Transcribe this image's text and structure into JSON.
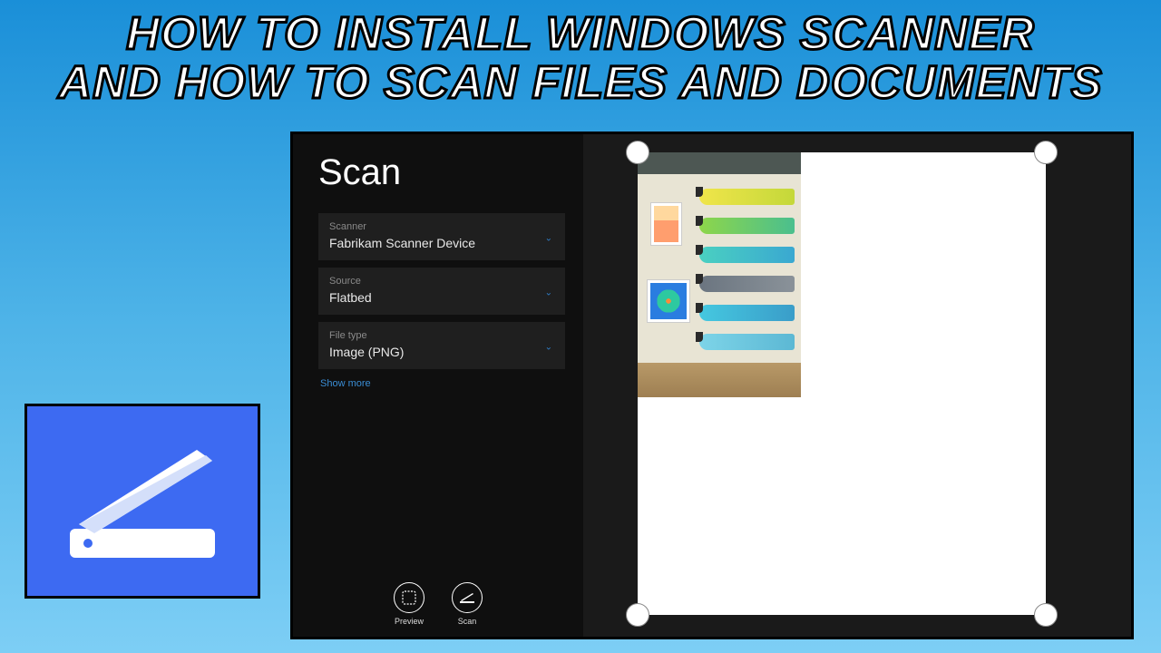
{
  "overlay": {
    "title_line1": "HOW TO INSTALL WINDOWS SCANNER",
    "title_line2": "AND HOW TO SCAN FILES AND DOCUMENTS"
  },
  "app": {
    "title": "Scan",
    "scanner": {
      "label": "Scanner",
      "value": "Fabrikam Scanner Device"
    },
    "source": {
      "label": "Source",
      "value": "Flatbed"
    },
    "filetype": {
      "label": "File type",
      "value": "Image (PNG)"
    },
    "show_more": "Show more",
    "buttons": {
      "preview": "Preview",
      "scan": "Scan"
    }
  }
}
